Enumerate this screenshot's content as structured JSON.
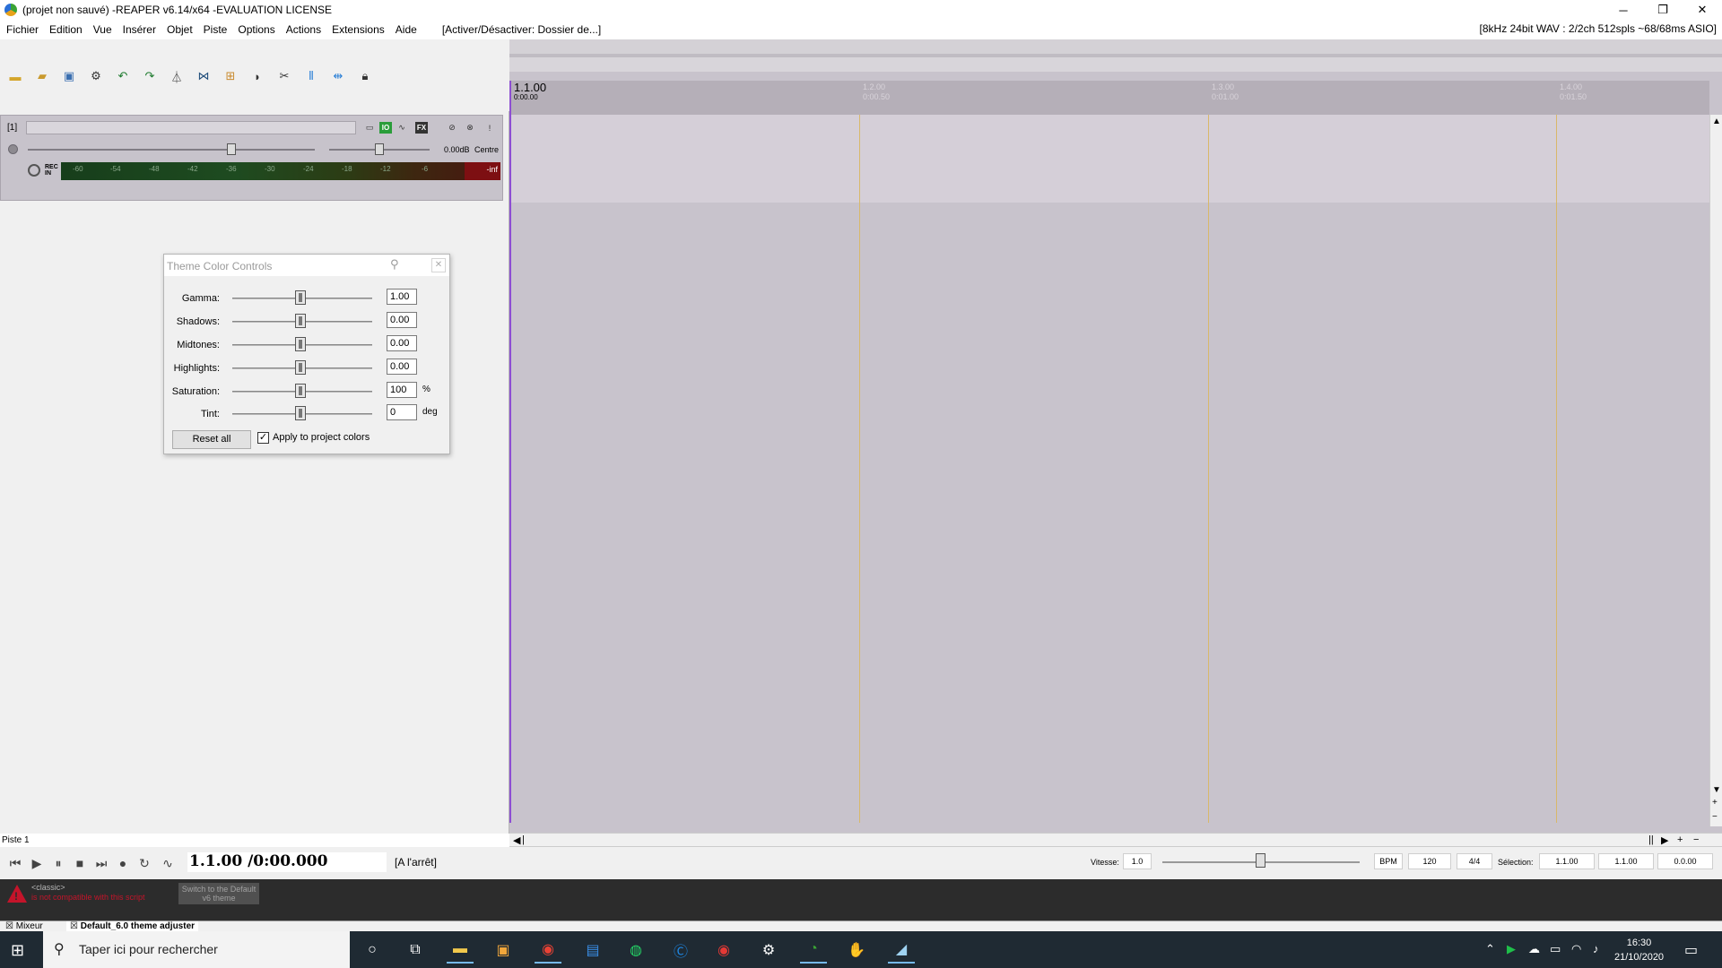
{
  "window": {
    "title": "(projet non sauvé) -REAPER v6.14/x64 -EVALUATION LICENSE",
    "minimize": "─",
    "restore": "❐",
    "close": "✕"
  },
  "menu": {
    "items": [
      "Fichier",
      "Edition",
      "Vue",
      "Insérer",
      "Objet",
      "Piste",
      "Options",
      "Actions",
      "Extensions",
      "Aide"
    ],
    "toggle": "[Activer/Désactiver: Dossier de...]",
    "status": "[8kHz 24bit WAV : 2/2ch 512spls ~68/68ms ASIO]"
  },
  "toolbar_icons": [
    "new-project-icon",
    "open-project-icon",
    "save-project-icon",
    "project-settings-icon",
    "undo-icon",
    "redo-icon",
    "metronome-icon",
    "snap-icon",
    "grid-icon",
    "ripple-icon",
    "auto-crossfade-icon",
    "envelope-lock-icon",
    "grid-lines-icon",
    "split-icon",
    "lock-icon"
  ],
  "track": {
    "number": "[1]",
    "volume_label": "0.00dB",
    "pan_label": "Centre",
    "rec_in": [
      "REC",
      "IN"
    ],
    "meter_ticks": [
      "-60",
      "-54",
      "-48",
      "-42",
      "-36",
      "-30",
      "-24",
      "-18",
      "-12",
      "-6"
    ],
    "peak": "-inf",
    "fx_label": "FX",
    "io_label": "IO"
  },
  "piste_label": "Piste 1",
  "theme_dialog": {
    "title": "Theme Color Controls",
    "rows": [
      {
        "label": "Gamma:",
        "value": "1.00",
        "unit": ""
      },
      {
        "label": "Shadows:",
        "value": "0.00",
        "unit": ""
      },
      {
        "label": "Midtones:",
        "value": "0.00",
        "unit": ""
      },
      {
        "label": "Highlights:",
        "value": "0.00",
        "unit": ""
      },
      {
        "label": "Saturation:",
        "value": "100",
        "unit": "%"
      },
      {
        "label": "Tint:",
        "value": "0",
        "unit": "deg"
      }
    ],
    "reset_label": "Reset all",
    "apply_checked": true,
    "apply_label": "Apply to project colors"
  },
  "ruler": {
    "markers": [
      {
        "bar": "1.1.00",
        "time": "0:00.00"
      },
      {
        "bar": "1.2.00",
        "time": "0:00.50"
      },
      {
        "bar": "1.3.00",
        "time": "0:01.00"
      },
      {
        "bar": "1.4.00",
        "time": "0:01.50"
      }
    ]
  },
  "transport": {
    "time": "1.1.00 /0:00.000",
    "state": "[A l'arrêt]",
    "vitesse_label": "Vitesse:",
    "vitesse_value": "1.0",
    "bpm_label": "BPM",
    "bpm_value": "120",
    "signature": "4/4",
    "selection_label": "Sélection:",
    "sel_start": "1.1.00",
    "sel_end": "1.1.00",
    "sel_len": "0.0.00"
  },
  "script_message": {
    "line1": "<classic>",
    "line2": "is not compatible with this script",
    "switch_label": "Switch to the Default v6 theme"
  },
  "docker_tabs": [
    "Mixeur",
    "Default_6.0 theme adjuster"
  ],
  "taskbar": {
    "search_placeholder": "Taper ici pour rechercher",
    "time": "16:30",
    "date": "21/10/2020"
  },
  "colors": {
    "play_cursor": "#8d4fd2",
    "grid_line": "#d9b86a",
    "meter_peak": "#7d0f12",
    "warning": "#c4142a"
  }
}
